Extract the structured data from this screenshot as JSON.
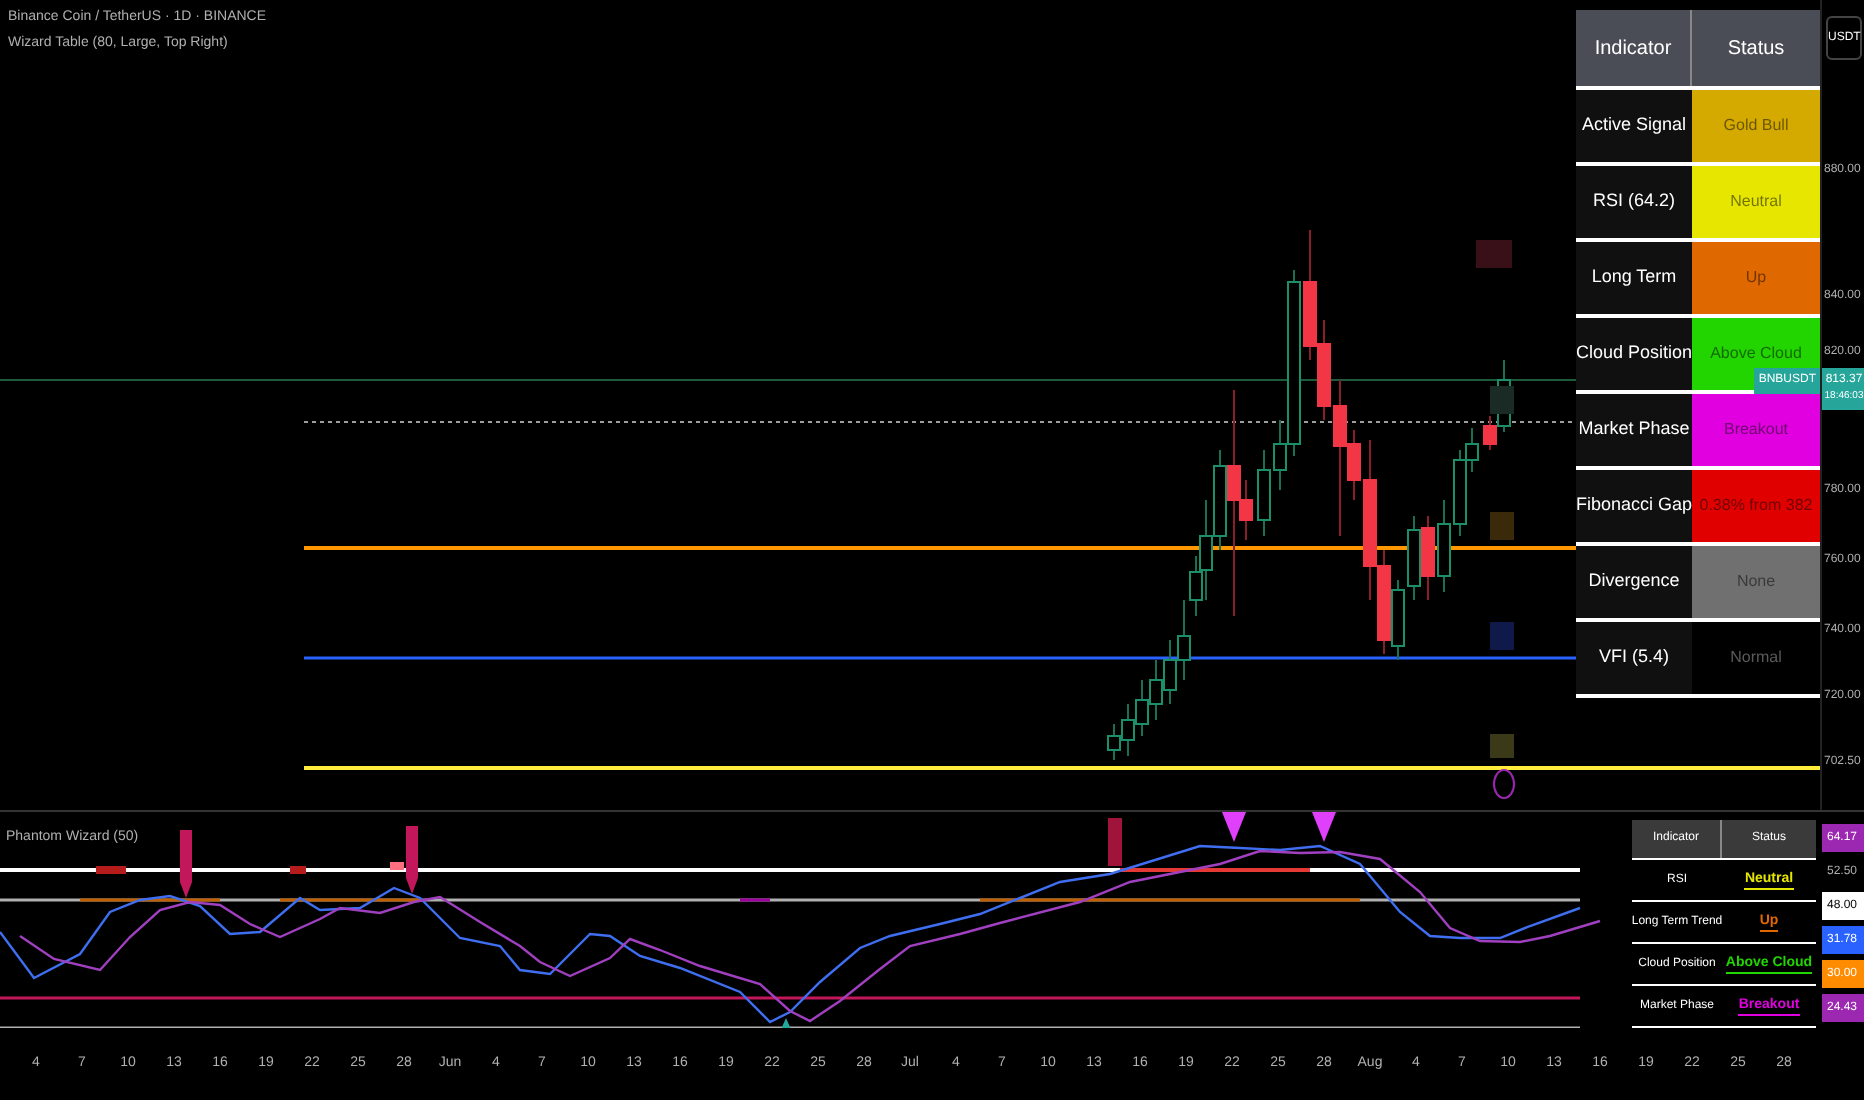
{
  "header": {
    "symbol": "Binance Coin / TetherUS · 1D · BINANCE",
    "indicator": "Wizard Table (80, Large, Top Right)"
  },
  "currency_button": "USDT",
  "price_axis": {
    "ticks": [
      "880.00",
      "840.00",
      "820.00",
      "780.00",
      "760.00",
      "740.00",
      "720.00",
      "702.50"
    ],
    "symbol_tag": "BNBUSDT",
    "price": "813.37",
    "countdown": "18:46:03"
  },
  "wizard_table": {
    "columns": [
      "Indicator",
      "Status"
    ],
    "rows": [
      {
        "indicator": "Active Signal",
        "status": "Gold Bull",
        "color": "#d4aa00"
      },
      {
        "indicator": "RSI (64.2)",
        "status": "Neutral",
        "color": "#e6e600"
      },
      {
        "indicator": "Long Term",
        "status": "Up",
        "color": "#e06800"
      },
      {
        "indicator": "Cloud Position",
        "status": "Above Cloud",
        "color": "#22d400"
      },
      {
        "indicator": "Market Phase",
        "status": "Breakout",
        "color": "#e000e0"
      },
      {
        "indicator": "Fibonacci Gap",
        "status": "0.38% from 382",
        "color": "#e00000"
      },
      {
        "indicator": "Divergence",
        "status": "None",
        "color": "#707070"
      },
      {
        "indicator": "VFI (5.4)",
        "status": "Normal",
        "color": "#000000"
      }
    ]
  },
  "oscillator": {
    "title": "Phantom Wizard (50)",
    "axis": [
      {
        "label": "64.17",
        "color": "#9c27b0"
      },
      {
        "label": "52.50",
        "color": "#000000"
      },
      {
        "label": "48.00",
        "color": "#ffffff"
      },
      {
        "label": "31.78",
        "color": "#2962ff"
      },
      {
        "label": "30.00",
        "color": "#ff8c00"
      },
      {
        "label": "24.43",
        "color": "#9c27b0"
      }
    ],
    "table": {
      "columns": [
        "Indicator",
        "Status"
      ],
      "rows": [
        {
          "indicator": "RSI",
          "status": "Neutral",
          "color": "#e6e600"
        },
        {
          "indicator": "Long Term Trend",
          "status": "Up",
          "color": "#e06800"
        },
        {
          "indicator": "Cloud Position",
          "status": "Above Cloud",
          "color": "#22d400"
        },
        {
          "indicator": "Market Phase",
          "status": "Breakout",
          "color": "#e000e0"
        }
      ]
    }
  },
  "time_axis": [
    "4",
    "7",
    "10",
    "13",
    "16",
    "19",
    "22",
    "25",
    "28",
    "Jun",
    "4",
    "7",
    "10",
    "13",
    "16",
    "19",
    "22",
    "25",
    "28",
    "Jul",
    "4",
    "7",
    "10",
    "13",
    "16",
    "19",
    "22",
    "25",
    "28",
    "Aug",
    "4",
    "7",
    "10",
    "13",
    "16",
    "19",
    "22",
    "25",
    "28"
  ]
}
